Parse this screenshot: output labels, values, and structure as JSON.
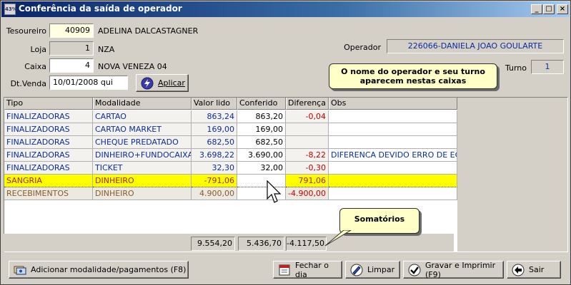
{
  "window": {
    "title": "Conferência da saída de operador",
    "icon_text": "43%",
    "minimize": "_",
    "maximize": "□",
    "close": "×"
  },
  "form": {
    "tesoureiro_label": "Tesoureiro",
    "tesoureiro_code": "40909",
    "tesoureiro_name": "ADELINA DALCASTAGNER",
    "loja_label": "Loja",
    "loja_code": "1",
    "loja_name": "NZA",
    "caixa_label": "Caixa",
    "caixa_code": "4",
    "caixa_name": "NOVA VENEZA 04",
    "dtvenda_label": "Dt.Venda",
    "dtvenda_value": "10/01/2008 qui",
    "aplicar_label": "Aplicar",
    "operador_label": "Operador",
    "operador_value": "226066-DANIELA JOAO GOULARTE",
    "turno_label": "Turno",
    "turno_value": "1"
  },
  "callouts": {
    "operador_note": "O nome do operador e seu turno aparecem nestas caixas",
    "somatorios": "Somatórios"
  },
  "grid": {
    "headers": [
      "Tipo",
      "Modalidade",
      "Valor lido",
      "Conferido",
      "Diferença",
      "Obs"
    ],
    "rows": [
      {
        "tipo": "FINALIZADORAS",
        "modalidade": "CARTAO",
        "valor": "863,24",
        "conferido": "863,20",
        "diferenca": "-0,04",
        "obs": ""
      },
      {
        "tipo": "FINALIZADORAS",
        "modalidade": "CARTAO MARKET",
        "valor": "169,00",
        "conferido": "169,00",
        "diferenca": "",
        "obs": ""
      },
      {
        "tipo": "FINALIZADORAS",
        "modalidade": "CHEQUE PREDATADO",
        "valor": "682,50",
        "conferido": "682,50",
        "diferenca": "",
        "obs": ""
      },
      {
        "tipo": "FINALIZADORAS",
        "modalidade": "DINHEIRO+FUNDOCAIXA",
        "valor": "3.698,22",
        "conferido": "3.690,00",
        "diferenca": "-8,22",
        "obs": "DIFERENCA DEVIDO ERRO DE ECF"
      },
      {
        "tipo": "FINALIZADORAS",
        "modalidade": "TICKET",
        "valor": "32,30",
        "conferido": "32,00",
        "diferenca": "-0,30",
        "obs": ""
      },
      {
        "tipo": "SANGRIA",
        "modalidade": "DINHEIRO",
        "valor": "-791,06",
        "conferido": "",
        "diferenca": "791,06",
        "obs": ""
      },
      {
        "tipo": "RECEBIMENTOS",
        "modalidade": "DINHEIRO",
        "valor": "4.900,00",
        "conferido": "",
        "diferenca": "-4.900,00",
        "obs": ""
      }
    ],
    "totals": {
      "valor": "9.554,20",
      "conferido": "5.436,70",
      "diferenca": "-4.117,50"
    }
  },
  "buttons": {
    "adicionar": "Adicionar modalidade/pagamentos (F8)",
    "fechar": "Fechar o dia",
    "limpar": "Limpar",
    "gravar": "Gravar e Imprimir (F9)",
    "sair": "Sair"
  },
  "colors": {
    "finalizadoras_text": "#0b2d9c",
    "sangria_bg": "#ffff00",
    "sangria_text": "#b02000",
    "recebimentos_text": "#8a5a2a",
    "negative": "#c00000"
  }
}
